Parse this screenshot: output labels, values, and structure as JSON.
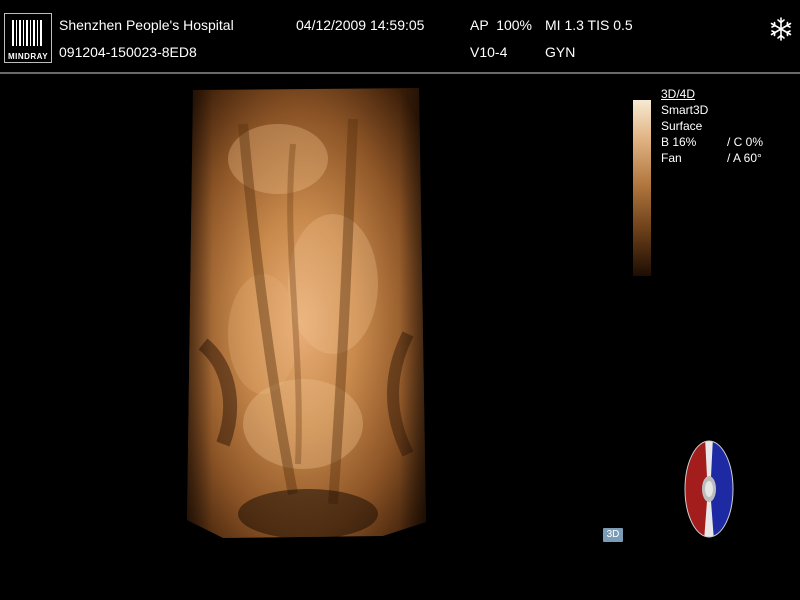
{
  "header": {
    "logo_text": "MINDRAY",
    "hospital": "Shenzhen People's Hospital",
    "patient_id": "091204-150023-8ED8",
    "datetime": "04/12/2009 14:59:05",
    "ap": "AP  100%",
    "mi_tis": "MI 1.3 TIS 0.5",
    "probe": "V10-4",
    "exam": "GYN",
    "status_icon": "snowflake-icon"
  },
  "params": {
    "mode": "3D/4D",
    "render": "Smart3D",
    "surface": "Surface",
    "b": "B 16%",
    "c": "/ C 0%",
    "fan": "Fan",
    "a": "/ A 60°"
  },
  "mode_badge": "3D",
  "colors": {
    "background": "#000000",
    "volume_tint": "#c8874a",
    "colorbar_top": "#f7ead2",
    "colorbar_bottom": "#1d0d03",
    "orientation_red": "#a31d1d",
    "orientation_blue": "#1e2aa3",
    "badge": "#7a9cb6"
  }
}
